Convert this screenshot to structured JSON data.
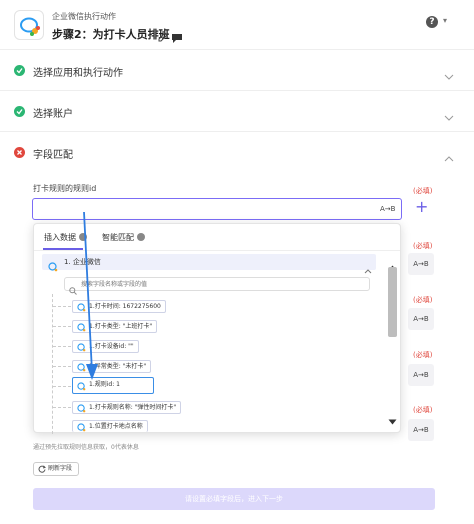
{
  "header": {
    "app_name": "企业微信执行动作",
    "step_title": "步骤2：为打卡人员排班"
  },
  "sections": [
    {
      "label": "选择应用和执行动作",
      "status": "ok"
    },
    {
      "label": "选择账户",
      "status": "ok"
    },
    {
      "label": "字段匹配",
      "status": "error"
    }
  ],
  "field": {
    "label": "打卡规则的规则id",
    "required_label": "(必填)",
    "ab_label": "A→B"
  },
  "side_rows": [
    {
      "required": "(必填)",
      "chip": "A→B"
    },
    {
      "required": "(必填)",
      "chip": "A→B"
    },
    {
      "required": "(必填)",
      "chip": "A→B"
    },
    {
      "required": "(必填)",
      "chip": "A→B"
    }
  ],
  "popup": {
    "tabs": [
      {
        "label": "插入数据",
        "active": true
      },
      {
        "label": "智能匹配",
        "active": false
      }
    ],
    "tree_root": "1. 企业微信",
    "search_placeholder": "搜索字段名称或字段的值",
    "items": [
      {
        "text": "1.打卡时间: 1672275600",
        "selected": false
      },
      {
        "text": "1.打卡类型: \"上班打卡\"",
        "selected": false
      },
      {
        "text": "1.打卡设备id: \"\"",
        "selected": false
      },
      {
        "text": "1.异常类型: \"未打卡\"",
        "selected": false
      },
      {
        "text": "1.规则id: 1",
        "selected": true
      },
      {
        "text": "1.打卡规则名称: \"弹性时间打卡\"",
        "selected": false
      },
      {
        "text": "1.位置打卡地点名称",
        "selected": false
      }
    ]
  },
  "hint_text": "通过预先拉取规则信息获取，0代表休息",
  "refresh_label": "刷新字段",
  "next_label": "请设置必填字段后，进入下一步",
  "colors": {
    "accent": "#6a5ee6",
    "ok": "#2bb673",
    "error": "#e0473d",
    "selection": "#3a8ee6",
    "arrow": "#2f7de0"
  }
}
